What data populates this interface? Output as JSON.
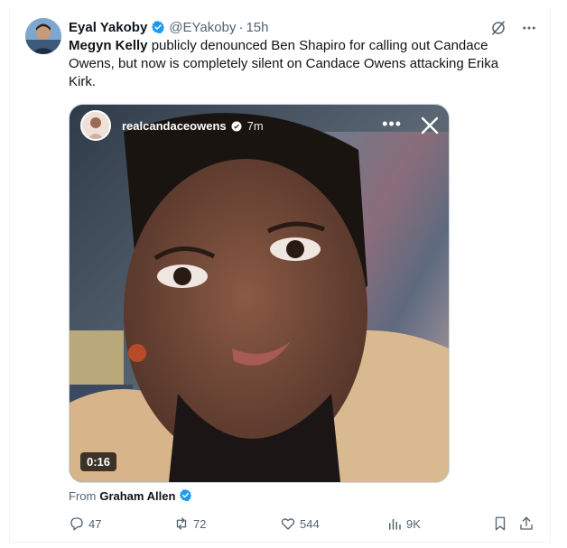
{
  "tweet": {
    "author_name": "Eyal Yakoby",
    "handle": "@EYakoby",
    "separator": "·",
    "time": "15h",
    "text_bold": "Megyn Kelly",
    "text_rest": " publicly denounced Ben Shapiro for calling out Candace Owens, but now is completely silent on Candace Owens attacking Erika Kirk."
  },
  "media": {
    "story_user": "realcandaceowens",
    "story_time": "7m",
    "more_label": "•••",
    "duration": "0:16"
  },
  "attribution": {
    "prefix": "From",
    "name": "Graham Allen"
  },
  "actions": {
    "replies": "47",
    "reposts": "72",
    "likes": "544",
    "views": "9K"
  },
  "colors": {
    "verified": "#1d9bf0",
    "text": "#0f1419",
    "muted": "#536471",
    "border": "#eff3f4"
  },
  "icons": [
    "grok-icon",
    "more-icon",
    "verified-badge-icon",
    "reply-icon",
    "repost-icon",
    "like-icon",
    "views-icon",
    "bookmark-icon",
    "share-icon",
    "close-icon"
  ]
}
